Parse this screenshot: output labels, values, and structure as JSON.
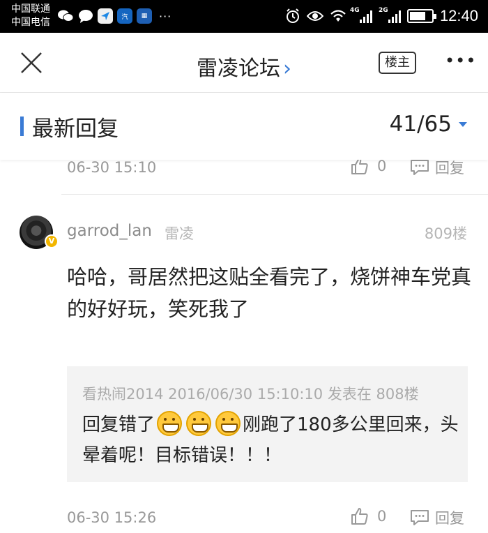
{
  "status_bar": {
    "carrier1": "中国联通",
    "carrier2": "中国电信",
    "time": "12:40",
    "network1": "4G",
    "network2": "2G",
    "battery_level": 0.75,
    "icons": [
      "wechat-icon",
      "message-icon",
      "navigation-app-icon",
      "autohome-app-icon",
      "app-icon",
      "more-dots-icon",
      "alarm-icon",
      "eye-icon",
      "wifi-icon",
      "signal-icon",
      "battery-icon"
    ]
  },
  "navbar": {
    "title": "雷凌论坛",
    "chevron": "›",
    "owner_button": "楼主",
    "more": "•••"
  },
  "section": {
    "title": "最新回复",
    "page_counter": "41/65",
    "accent": "#3a7bd5"
  },
  "prev_post": {
    "time": "06-30 15:10",
    "likes": "0",
    "reply_label": "回复"
  },
  "post": {
    "username": "garrod_lan",
    "user_tag": "雷凌",
    "floor": "809楼",
    "content": "哈哈，哥居然把这贴全看完了，烧饼神车党真的好好玩，笑死我了",
    "quote": {
      "meta": "看热闹2014 2016/06/30 15:10:10 发表在 808楼",
      "text_before": "回复错了",
      "text_after": "刚跑了180多公里回来，头晕着呢！目标错误！！！",
      "emoji_count": 3
    },
    "time": "06-30 15:26",
    "likes": "0",
    "reply_label": "回复"
  }
}
